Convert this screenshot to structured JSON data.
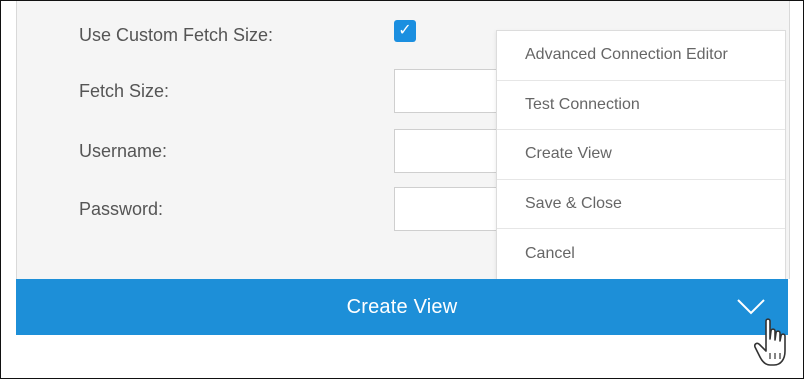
{
  "form": {
    "custom_fetch_label": "Use Custom Fetch Size:",
    "fetch_size_label": "Fetch Size:",
    "username_label": "Username:",
    "password_label": "Password:",
    "custom_fetch_checked": true,
    "checkmark_icon": "✓"
  },
  "dropdown": {
    "items": [
      {
        "label": "Advanced Connection Editor"
      },
      {
        "label": "Test Connection"
      },
      {
        "label": "Create View"
      },
      {
        "label": "Save & Close"
      },
      {
        "label": "Cancel"
      }
    ]
  },
  "action_bar": {
    "label": "Create View",
    "chevron_icon": "chevron-down-icon",
    "color": "#1d8fd8"
  },
  "cursor": {
    "icon": "hand-pointer-icon"
  }
}
